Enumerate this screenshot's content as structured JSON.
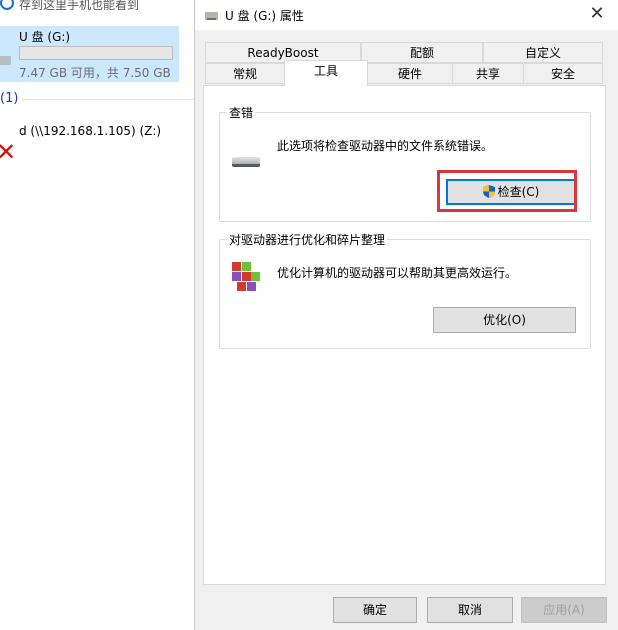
{
  "explorer": {
    "top_hint": "存到这里手机也能看到",
    "drive": {
      "name": "U 盘 (G:)",
      "usage_fraction": 0.0,
      "size_text": "7.47 GB 可用，共 7.50 GB"
    },
    "network_section_title": "(1)",
    "network_drive_name": "d (\\\\192.168.1.105) (Z:)"
  },
  "dialog": {
    "title": "U 盘 (G:) 属性",
    "close_glyph": "✕",
    "tabs_row1": [
      "ReadyBoost",
      "配额",
      "自定义"
    ],
    "tabs_row2": [
      "常规",
      "工具",
      "硬件",
      "共享",
      "安全"
    ],
    "active_tab": "工具",
    "error_check": {
      "group_label": "查错",
      "description": "此选项将检查驱动器中的文件系统错误。",
      "button_label": "检查(C)"
    },
    "optimize": {
      "group_label": "对驱动器进行优化和碎片整理",
      "description": "优化计算机的驱动器可以帮助其更高效运行。",
      "button_label": "优化(O)"
    },
    "footer": {
      "ok_label": "确定",
      "cancel_label": "取消",
      "apply_label": "应用(A)"
    }
  },
  "colors": {
    "selection_bg": "#cce8ff",
    "focus_blue": "#0078d7",
    "highlight_red": "#d9363e",
    "error_red": "#d10f0f"
  }
}
